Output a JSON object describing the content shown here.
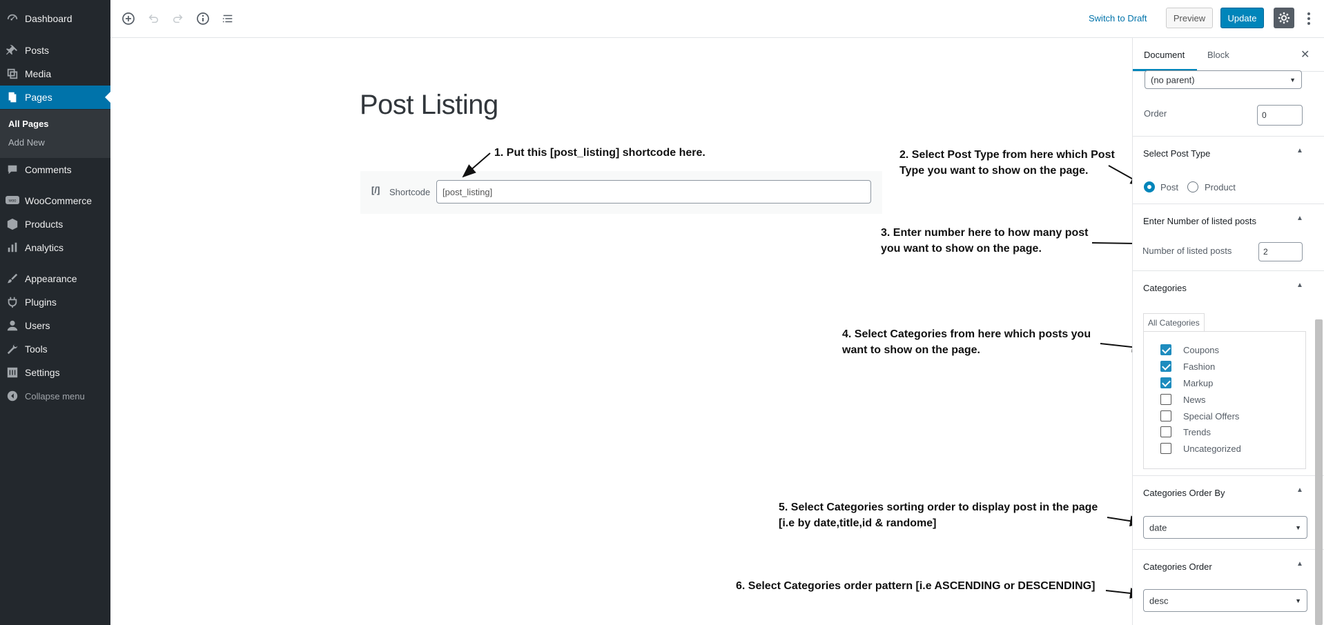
{
  "sidebar": {
    "items": [
      {
        "label": "Dashboard",
        "icon": "dashboard-icon"
      },
      {
        "label": "Posts",
        "icon": "pin-icon"
      },
      {
        "label": "Media",
        "icon": "media-icon"
      },
      {
        "label": "Pages",
        "icon": "pages-icon"
      },
      {
        "label": "Comments",
        "icon": "comment-icon"
      },
      {
        "label": "WooCommerce",
        "icon": "woocommerce-icon"
      },
      {
        "label": "Products",
        "icon": "products-icon"
      },
      {
        "label": "Analytics",
        "icon": "analytics-icon"
      },
      {
        "label": "Appearance",
        "icon": "appearance-icon"
      },
      {
        "label": "Plugins",
        "icon": "plugins-icon"
      },
      {
        "label": "Users",
        "icon": "users-icon"
      },
      {
        "label": "Tools",
        "icon": "tools-icon"
      },
      {
        "label": "Settings",
        "icon": "settings-icon"
      },
      {
        "label": "Collapse menu",
        "icon": "collapse-icon"
      }
    ],
    "submenu": [
      "All Pages",
      "Add New"
    ],
    "accent": "#0073aa"
  },
  "toolbar": {
    "switch_to_draft": "Switch to Draft",
    "preview": "Preview",
    "update": "Update"
  },
  "editor": {
    "title": "Post Listing",
    "shortcode_icon": "[/]",
    "shortcode_label": "Shortcode",
    "shortcode_value": "[post_listing]"
  },
  "panel": {
    "tabs": [
      "Document",
      "Block"
    ],
    "parent_select": "(no parent)",
    "order_label": "Order",
    "order_value": "0",
    "post_type_title": "Select Post Type",
    "post_type_options": [
      "Post",
      "Product"
    ],
    "post_type_selected": "Post",
    "num_posts_title": "Enter Number of listed posts",
    "num_posts_label": "Number of listed posts",
    "num_posts_value": "2",
    "categories_title": "Categories",
    "categories_tab": "All Categories",
    "categories": [
      {
        "label": "Coupons",
        "checked": true
      },
      {
        "label": "Fashion",
        "checked": true
      },
      {
        "label": "Markup",
        "checked": true
      },
      {
        "label": "News",
        "checked": false
      },
      {
        "label": "Special Offers",
        "checked": false
      },
      {
        "label": "Trends",
        "checked": false
      },
      {
        "label": "Uncategorized",
        "checked": false
      }
    ],
    "order_by_title": "Categories Order By",
    "order_by_value": "date",
    "order_title": "Categories Order",
    "order_value_select": "desc"
  },
  "annotations": {
    "a1": "1. Put this [post_listing] shortcode here.",
    "a2_line1": "2. Select Post Type from here which Post",
    "a2_line2": "Type you want to show on the page.",
    "a3_line1": "3. Enter number here to how many post",
    "a3_line2": "you want to show on the page.",
    "a4_line1": "4. Select Categories from here which posts you",
    "a4_line2": "want to show on the page.",
    "a5_line1": "5. Select Categories sorting order to display post in the page",
    "a5_line2": "[i.e by date,title,id & randome]",
    "a6": "6. Select Categories order pattern [i.e ASCENDING or DESCENDING]"
  }
}
